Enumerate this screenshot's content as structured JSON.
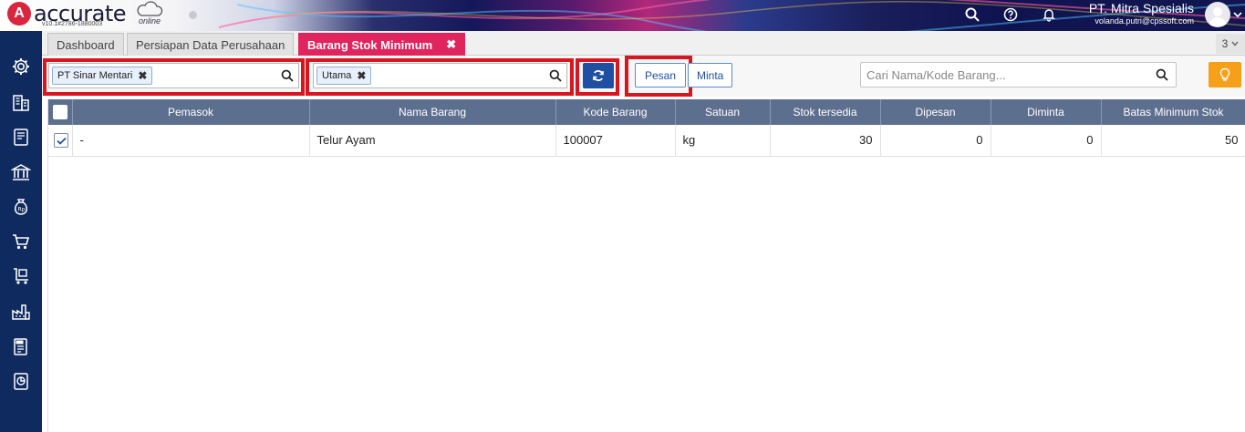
{
  "header": {
    "logo_mark": "A",
    "logo_text": "accurate",
    "logo_suffix": "online",
    "version": "v10.1#2786-1880003",
    "company_name": "PT. Mitra Spesialis",
    "user_email": "volanda.putri@cpssoft.com"
  },
  "tabs": [
    {
      "label": "Dashboard"
    },
    {
      "label": "Persiapan Data Perusahaan"
    },
    {
      "label": "Barang Stok Minimum",
      "close": "✖"
    }
  ],
  "tab_count": "3",
  "toolbar": {
    "supplier_chip": "PT Sinar Mentari",
    "warehouse_chip": "Utama",
    "chip_remove": "✖",
    "order_button": "Pesan",
    "request_button": "Minta",
    "search_placeholder": "Cari Nama/Kode Barang..."
  },
  "table": {
    "columns": [
      "Pemasok",
      "Nama Barang",
      "Kode Barang",
      "Satuan",
      "Stok tersedia",
      "Dipesan",
      "Diminta",
      "Batas Minimum Stok"
    ],
    "rows": [
      {
        "pemasok": "-",
        "nama": "Telur Ayam",
        "kode": "100007",
        "satuan": "kg",
        "stok": "30",
        "dipesan": "0",
        "diminta": "0",
        "batas": "50",
        "checked": true
      }
    ]
  },
  "colors": {
    "accent": "#e0245e",
    "sidebar": "#0f2a5f",
    "highlight": "#d8161f",
    "primary": "#1f4fa3"
  },
  "icons": {
    "sidebar": [
      "gear-icon",
      "building-icon",
      "document-icon",
      "bank-icon",
      "money-bag-icon",
      "cart-icon",
      "delivery-icon",
      "factory-icon",
      "tax-icon",
      "report-icon"
    ]
  }
}
